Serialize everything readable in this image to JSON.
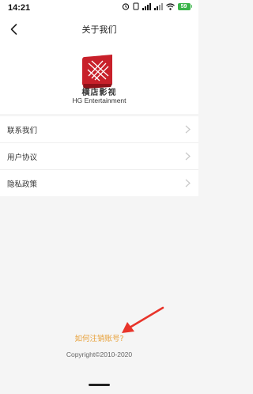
{
  "status_bar": {
    "time": "14:21",
    "battery": "59"
  },
  "nav": {
    "title": "关于我们"
  },
  "brand": {
    "name": "横店影视",
    "subtitle": "HG Entertainment"
  },
  "menu": {
    "items": [
      {
        "label": "联系我们"
      },
      {
        "label": "用户协议"
      },
      {
        "label": "隐私政策"
      }
    ]
  },
  "footer": {
    "deregister_link": "如何注销账号?",
    "copyright": "Copyright©2010-2020"
  },
  "colors": {
    "accent_link": "#e8a13a",
    "annotation_arrow": "#e8342a",
    "logo_red": "#c8202a",
    "battery_green": "#3ab54a"
  },
  "icons": [
    "back-arrow-icon",
    "chevron-right-icon",
    "alarm-icon",
    "signal-icon",
    "wifi-icon",
    "battery-icon"
  ]
}
